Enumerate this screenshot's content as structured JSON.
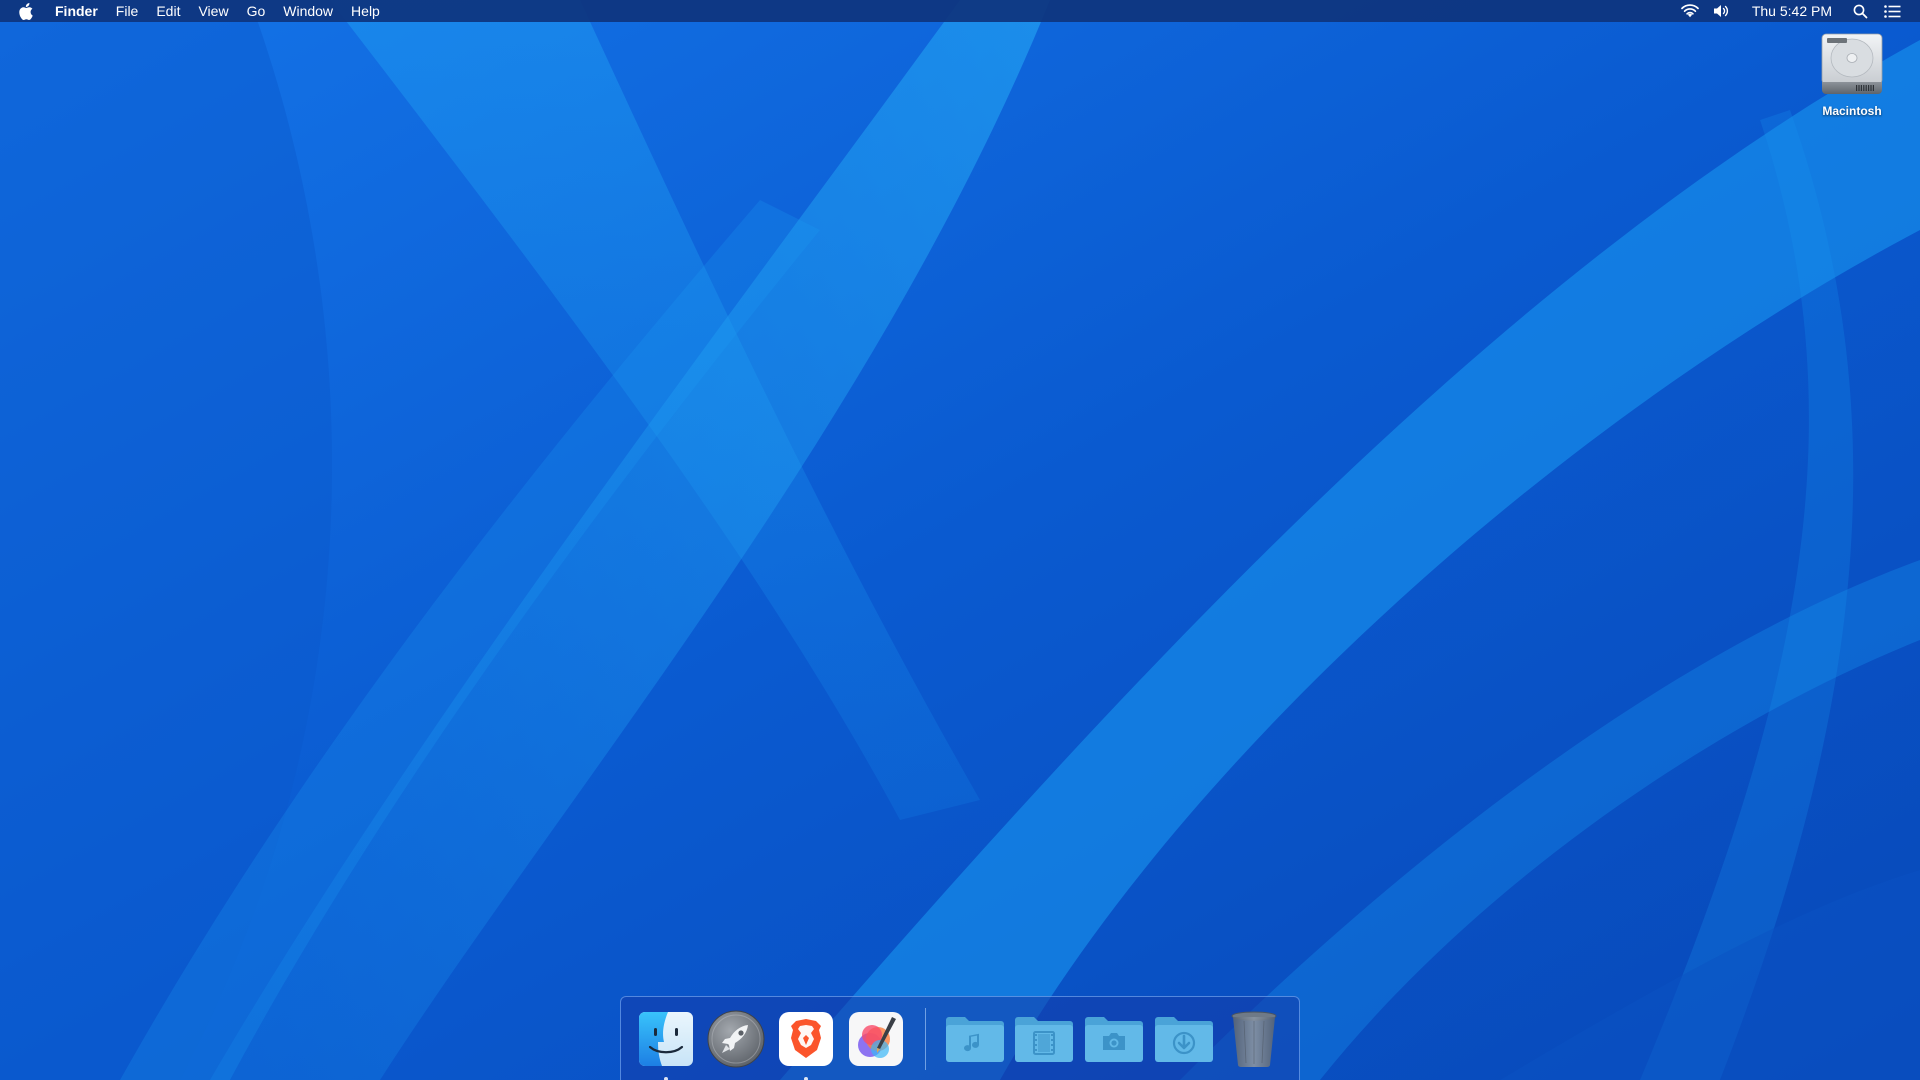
{
  "menubar": {
    "apple_icon": "apple-logo-icon",
    "app_name": "Finder",
    "menus": [
      "File",
      "Edit",
      "View",
      "Go",
      "Window",
      "Help"
    ],
    "status_icons": [
      "wifi-icon",
      "volume-icon"
    ],
    "clock": "Thu 5:42 PM",
    "right_icons": [
      "spotlight-search-icon",
      "notification-center-icon"
    ]
  },
  "desktop": {
    "icons": [
      {
        "label": "Macintosh",
        "icon": "hard-drive-icon"
      }
    ]
  },
  "dock": {
    "apps": [
      {
        "name": "finder",
        "icon": "finder-icon",
        "running": true
      },
      {
        "name": "launchpad",
        "icon": "launchpad-rocket-icon",
        "running": false
      },
      {
        "name": "brave",
        "icon": "brave-lion-icon",
        "running": true
      },
      {
        "name": "pixelmator",
        "icon": "pixelmator-icon",
        "running": false
      }
    ],
    "folders": [
      {
        "name": "music",
        "icon": "music-folder-icon"
      },
      {
        "name": "movies",
        "icon": "movies-folder-icon"
      },
      {
        "name": "pictures",
        "icon": "pictures-folder-icon"
      },
      {
        "name": "downloads",
        "icon": "downloads-folder-icon"
      }
    ],
    "trash": {
      "icon": "trash-icon"
    }
  },
  "colors": {
    "wallpaper_base": "#0b5fd6",
    "wallpaper_light": "#1aa3f5",
    "menubar_bg": "#0e347d",
    "folder_blue": "#5fb6e6",
    "brave_orange": "#fb542b"
  }
}
